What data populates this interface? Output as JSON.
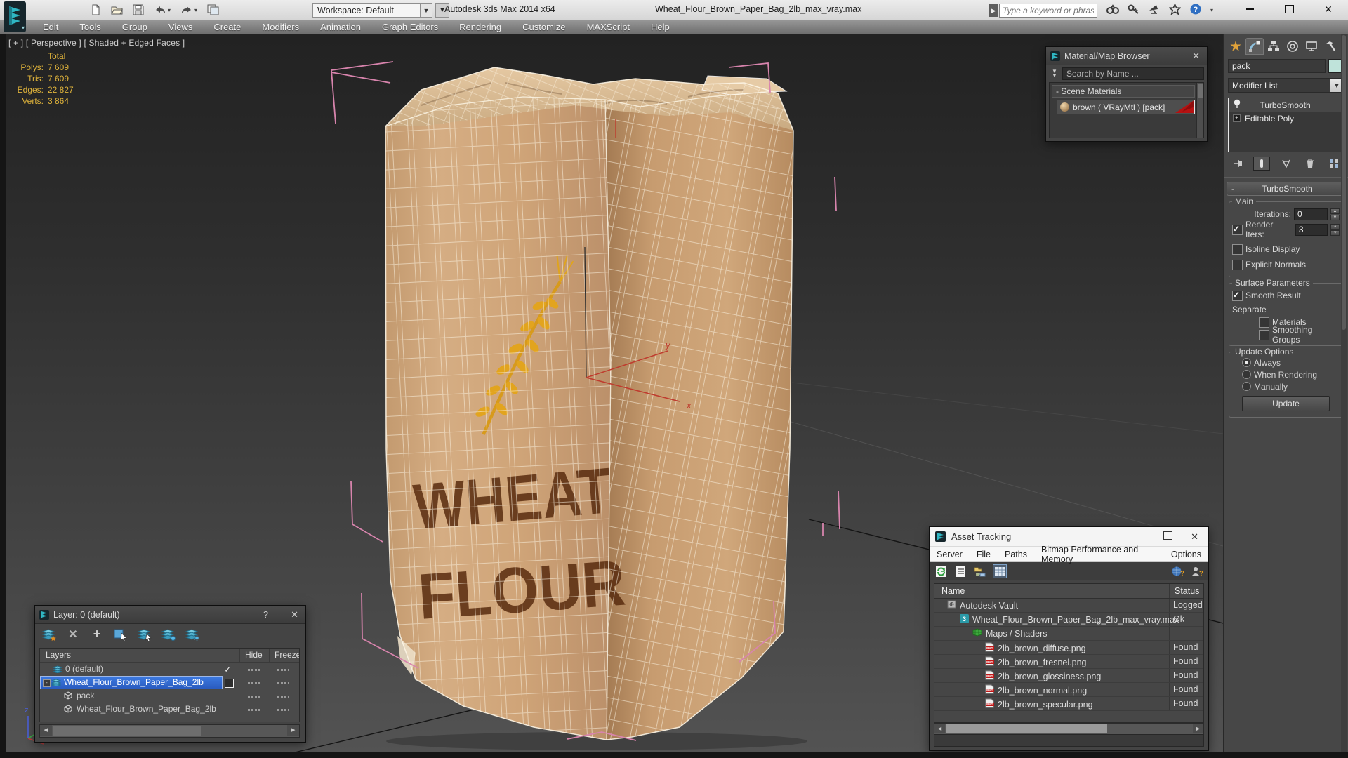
{
  "colors": {
    "accent_teal": "#2fb6c3",
    "selection_blue": "#2f6ad4",
    "stat_yellow": "#dfb33b",
    "bracket_pink": "#d884ad",
    "gizmo_red": "#bf3b2e",
    "bag_tan": "#cda27a",
    "material_red": "#b51212"
  },
  "titlebar": {
    "app_title": "Autodesk 3ds Max  2014 x64",
    "file_title": "Wheat_Flour_Brown_Paper_Bag_2lb_max_vray.max",
    "workspace": "Workspace: Default",
    "search_placeholder": "Type a keyword or phrase"
  },
  "menubar": {
    "items": [
      "Edit",
      "Tools",
      "Group",
      "Views",
      "Create",
      "Modifiers",
      "Animation",
      "Graph Editors",
      "Rendering",
      "Customize",
      "MAXScript",
      "Help"
    ]
  },
  "viewport": {
    "label": "[ + ] [ Perspective ] [ Shaded + Edged Faces ]",
    "stats_header": "Total",
    "stats": [
      {
        "label": "Polys:",
        "value": "7 609"
      },
      {
        "label": "Tris:",
        "value": "7 609"
      },
      {
        "label": "Edges:",
        "value": "22 827"
      },
      {
        "label": "Verts:",
        "value": "3 864"
      }
    ],
    "axis": {
      "x": "x",
      "y": "y",
      "z": "z"
    },
    "bag": {
      "line1": "WHEAT",
      "line2": "FLOUR"
    }
  },
  "material_browser": {
    "title": "Material/Map Browser",
    "close": "✕",
    "search": "Search by Name ...",
    "section": "- Scene Materials",
    "item": "brown  ( VRayMtl ) [pack]"
  },
  "command_panel": {
    "object_name": "pack",
    "modifier_list": "Modifier List",
    "stack": [
      {
        "label": "TurboSmooth",
        "icon": "bulb"
      },
      {
        "label": "Editable Poly",
        "icon": "plus"
      }
    ],
    "rollout_title": "TurboSmooth",
    "collapse": "-",
    "main_group": "Main",
    "iterations_label": "Iterations:",
    "iterations_value": "0",
    "render_iters_label": "Render Iters:",
    "render_iters_value": "3",
    "isoline": "Isoline Display",
    "explicit_normals": "Explicit Normals",
    "surface_group": "Surface Parameters",
    "smooth_result": "Smooth Result",
    "separate": "Separate",
    "materials": "Materials",
    "smoothing_groups": "Smoothing Groups",
    "update_group": "Update Options",
    "update_modes": [
      "Always",
      "When Rendering",
      "Manually"
    ],
    "update_selected": 0,
    "update_button": "Update"
  },
  "layer_dialog": {
    "title": "Layer: 0 (default)",
    "help": "?",
    "close": "✕",
    "columns": {
      "name": "Layers",
      "hide": "Hide",
      "freeze": "Freeze"
    },
    "rows": [
      {
        "name": "0 (default)",
        "type": "layer",
        "indent": 1,
        "current": true
      },
      {
        "name": "Wheat_Flour_Brown_Paper_Bag_2lb",
        "type": "layer",
        "indent": 0,
        "selected": true,
        "expanded": true
      },
      {
        "name": "pack",
        "type": "object",
        "indent": 2
      },
      {
        "name": "Wheat_Flour_Brown_Paper_Bag_2lb",
        "type": "object",
        "indent": 2
      }
    ]
  },
  "asset_tracking": {
    "title": "Asset Tracking",
    "menu": [
      "Server",
      "File",
      "Paths",
      "Bitmap Performance and Memory",
      "Options"
    ],
    "columns": {
      "name": "Name",
      "status": "Status"
    },
    "rows": [
      {
        "name": "Autodesk Vault",
        "status": "Logged O",
        "icon": "vault",
        "indent": 1
      },
      {
        "name": "Wheat_Flour_Brown_Paper_Bag_2lb_max_vray.max",
        "status": "Ok",
        "icon": "max",
        "indent": 2
      },
      {
        "name": "Maps / Shaders",
        "status": "",
        "icon": "maps",
        "indent": 3
      },
      {
        "name": "2lb_brown_diffuse.png",
        "status": "Found",
        "icon": "png",
        "indent": 4
      },
      {
        "name": "2lb_brown_fresnel.png",
        "status": "Found",
        "icon": "png",
        "indent": 4
      },
      {
        "name": "2lb_brown_glossiness.png",
        "status": "Found",
        "icon": "png",
        "indent": 4
      },
      {
        "name": "2lb_brown_normal.png",
        "status": "Found",
        "icon": "png",
        "indent": 4
      },
      {
        "name": "2lb_brown_specular.png",
        "status": "Found",
        "icon": "png",
        "indent": 4
      }
    ]
  }
}
